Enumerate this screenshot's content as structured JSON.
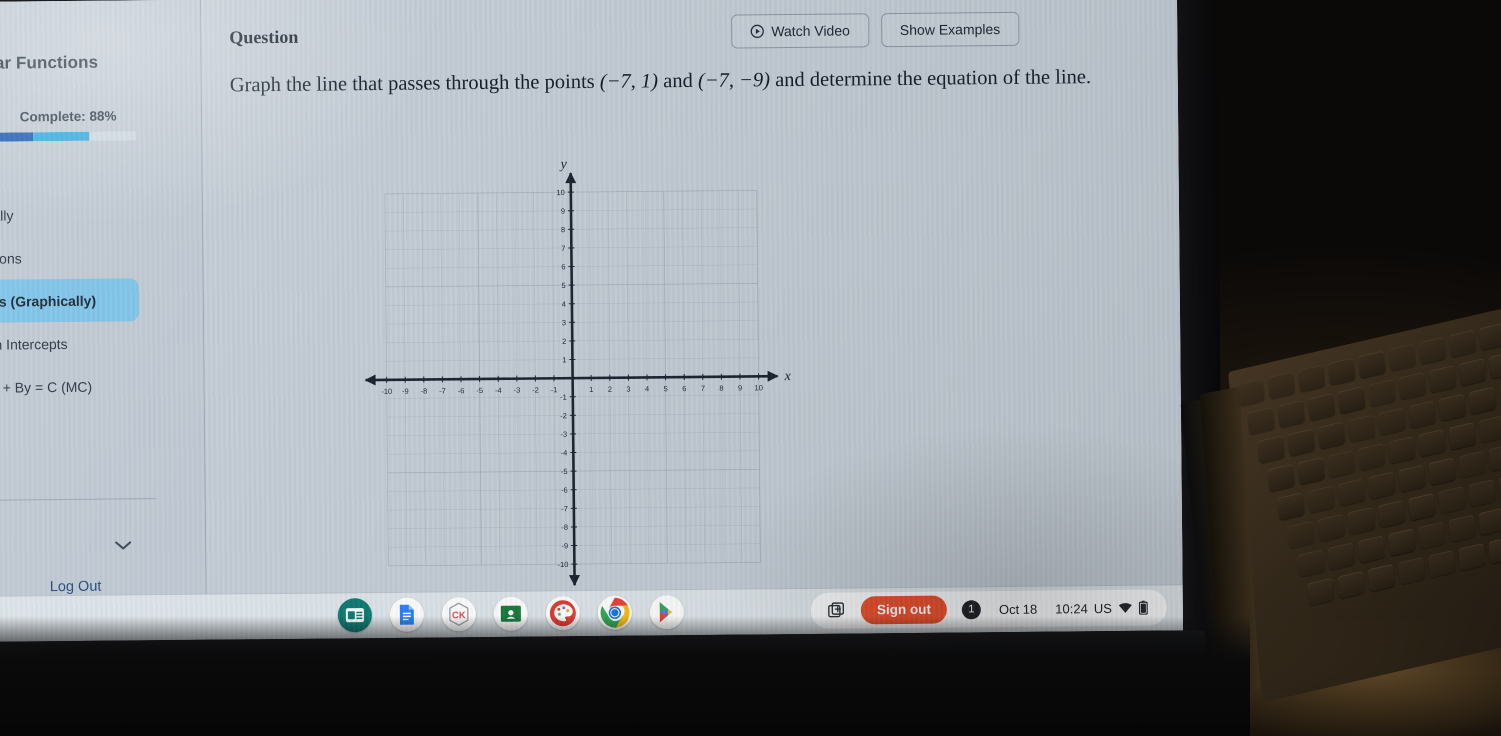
{
  "sidebar": {
    "title": "Linear Functions",
    "progress": {
      "label": "Complete: 88%",
      "percent": 88,
      "fill_color": "#1657b0",
      "fill_color_secondary": "#2fa7dd"
    },
    "items": [
      {
        "label": "aphically",
        "active": false
      },
      {
        "label": "Equations",
        "active": false
      },
      {
        "label": "Points (Graphically)",
        "active": true
      },
      {
        "label": "C from Intercepts",
        "active": false
      },
      {
        "label": "ion Ax + By = C (MC)",
        "active": false
      }
    ],
    "collapse_icon": "chevron-down-icon",
    "logout_label": "Log Out",
    "active_color": "#7cc3e8"
  },
  "question": {
    "heading": "Question",
    "watch_video_label": "Watch Video",
    "show_examples_label": "Show Examples",
    "play_icon": "play-circle-icon",
    "prompt_part1": "Graph the line that passes through the points ",
    "point_a": "(−7, 1)",
    "prompt_mid": " and ",
    "point_b": "(−7, −9)",
    "prompt_part2": " and determine the equation of the line."
  },
  "chart_data": {
    "type": "scatter",
    "title": "",
    "xlabel": "x",
    "ylabel": "y",
    "xlim": [
      -10,
      10
    ],
    "ylim": [
      -10,
      10
    ],
    "xticks": [
      -10,
      -9,
      -8,
      -7,
      -6,
      -5,
      -4,
      -3,
      -2,
      -1,
      1,
      2,
      3,
      4,
      5,
      6,
      7,
      8,
      9,
      10
    ],
    "yticks": [
      10,
      9,
      8,
      7,
      6,
      5,
      4,
      3,
      2,
      1,
      -1,
      -2,
      -3,
      -4,
      -5,
      -6,
      -7,
      -8,
      -9,
      -10
    ],
    "grid": true,
    "grid_step": 1,
    "axis_arrows": true,
    "series": [],
    "points": [],
    "annotations": [],
    "legend": "none",
    "note": "Empty interactive coordinate plane; no line has been plotted yet."
  },
  "shelf": {
    "apps": [
      {
        "name": "school-app-icon",
        "color": "#0f7a73"
      },
      {
        "name": "google-docs-icon",
        "color": "#2a84f4"
      },
      {
        "name": "ck12-icon",
        "color": "#d9534f"
      },
      {
        "name": "google-classroom-icon",
        "color": "#1a7a3c"
      },
      {
        "name": "art-palette-icon",
        "color": "#e03c2f"
      },
      {
        "name": "chrome-icon",
        "color": "#4285f4"
      },
      {
        "name": "play-store-icon",
        "color": "#4a7ff0"
      }
    ],
    "status": {
      "capture_icon": "screen-capture-icon",
      "signout_label": "Sign out",
      "signout_color": "#e8502e",
      "notification_count": "1",
      "date": "Oct 18",
      "time": "10:24",
      "locale": "US",
      "wifi_icon": "wifi-icon",
      "battery_icon": "battery-icon"
    }
  }
}
